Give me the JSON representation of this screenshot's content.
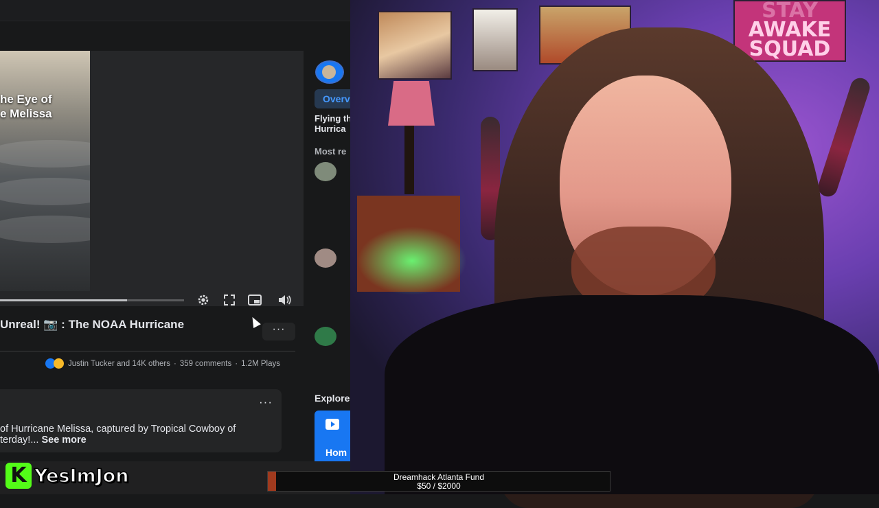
{
  "video": {
    "thumbnail_title_line1": "he Eye of",
    "thumbnail_title_line2": "e Melissa",
    "progress_fraction": 0.69,
    "title": "Unreal! 📷 : The NOAA Hurricane",
    "reactions_text": "Justin Tucker and 14K others",
    "comments": "359 comments",
    "plays": "1.2M Plays",
    "separator": "·",
    "more_glyph": "···",
    "description_line1": "of Hurricane Melissa, captured by Tropical Cowboy of",
    "description_line2": "terday!...",
    "see_more": "See more"
  },
  "icons": {
    "settings": "gear-icon",
    "fullscreen": "fullscreen-icon",
    "pip": "picture-in-picture-icon",
    "volume": "volume-icon"
  },
  "sidebar": {
    "tab_label": "Overv",
    "post_line1": "Flying th",
    "post_line2": "Hurrica",
    "most_relevant": "Most re",
    "explore": "Explore",
    "home_label": "Hom"
  },
  "stream": {
    "handle": "YesImJon",
    "logo_letter": "K",
    "fund_title": "Dreamhack Atlanta Fund",
    "fund_amount": "$50 / $2000",
    "fund_progress": 0.025
  },
  "colors": {
    "facebook_blue": "#1877f2",
    "kick_green": "#53fc18",
    "fund_fill": "#a03a1e"
  },
  "webcam": {
    "poster_text_line1": "STAY",
    "poster_text_line2": "AWAKE",
    "poster_text_line3": "SQUAD"
  }
}
